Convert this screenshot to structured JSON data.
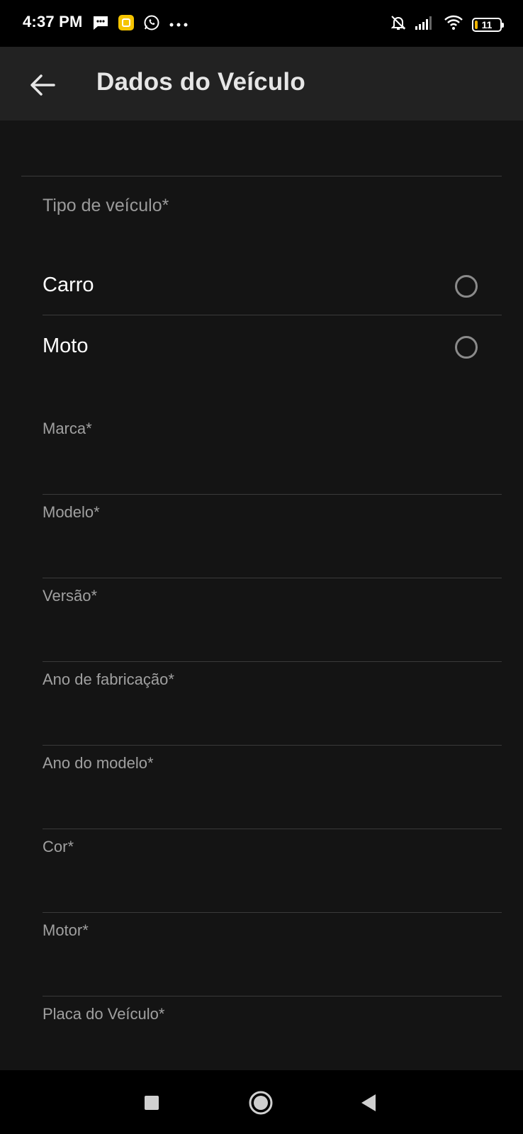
{
  "status_bar": {
    "time": "4:37 PM",
    "battery_level": "11",
    "icons": [
      "message-icon",
      "app-notification-icon",
      "whatsapp-icon",
      "more-dots-icon",
      "bell-off-icon",
      "signal-icon",
      "wifi-icon",
      "battery-icon"
    ]
  },
  "app_bar": {
    "title": "Dados do Veículo",
    "back_icon": "arrow-left-icon"
  },
  "vehicle_type": {
    "label": "Tipo de veículo*",
    "options": [
      {
        "label": "Carro",
        "selected": false
      },
      {
        "label": "Moto",
        "selected": false
      }
    ]
  },
  "fields": [
    {
      "label": "Marca*",
      "value": ""
    },
    {
      "label": "Modelo*",
      "value": ""
    },
    {
      "label": "Versão*",
      "value": ""
    },
    {
      "label": "Ano de fabricação*",
      "value": ""
    },
    {
      "label": "Ano do modelo*",
      "value": ""
    },
    {
      "label": "Cor*",
      "value": ""
    },
    {
      "label": "Motor*",
      "value": ""
    },
    {
      "label": "Placa do Veículo*",
      "value": ""
    }
  ],
  "nav_bar": {
    "icons": [
      "recent-apps-icon",
      "home-icon",
      "back-triangle-icon"
    ]
  },
  "colors": {
    "background": "#141414",
    "app_bar": "#222222",
    "label": "#9a9a9a",
    "divider": "#3a3a3a"
  }
}
